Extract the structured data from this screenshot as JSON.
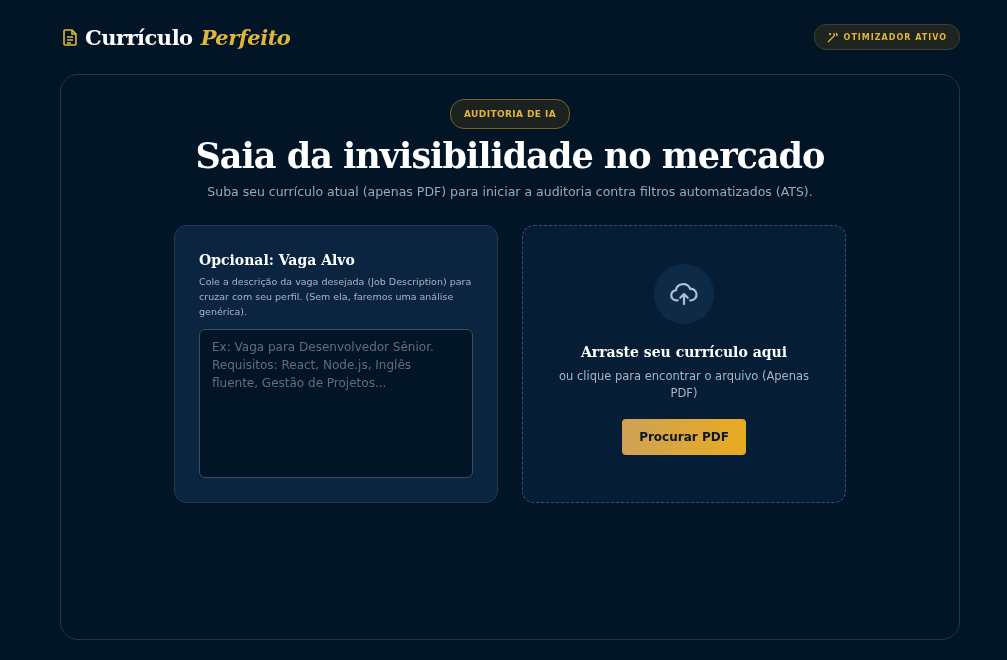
{
  "brand": {
    "name": "Currículo",
    "accent": "Perfeito"
  },
  "status_badge": {
    "label": "OTIMIZADOR ATIVO"
  },
  "hero": {
    "badge": "AUDITORIA DE IA",
    "title": "Saia da invisibilidade no mercado",
    "subtitle": "Suba seu currículo atual (apenas PDF) para iniciar a auditoria contra filtros automatizados (ATS)."
  },
  "job_card": {
    "title": "Opcional: Vaga Alvo",
    "description": "Cole a descrição da vaga desejada (Job Description) para cruzar com seu perfil. (Sem ela, faremos uma análise genérica).",
    "placeholder": "Ex: Vaga para Desenvolvedor Sênior. Requisitos: React, Node.js, Inglês fluente, Gestão de Projetos..."
  },
  "upload": {
    "title": "Arraste seu currículo aqui",
    "hint": "ou clique para encontrar o arquivo (Apenas PDF)",
    "button": "Procurar PDF"
  }
}
